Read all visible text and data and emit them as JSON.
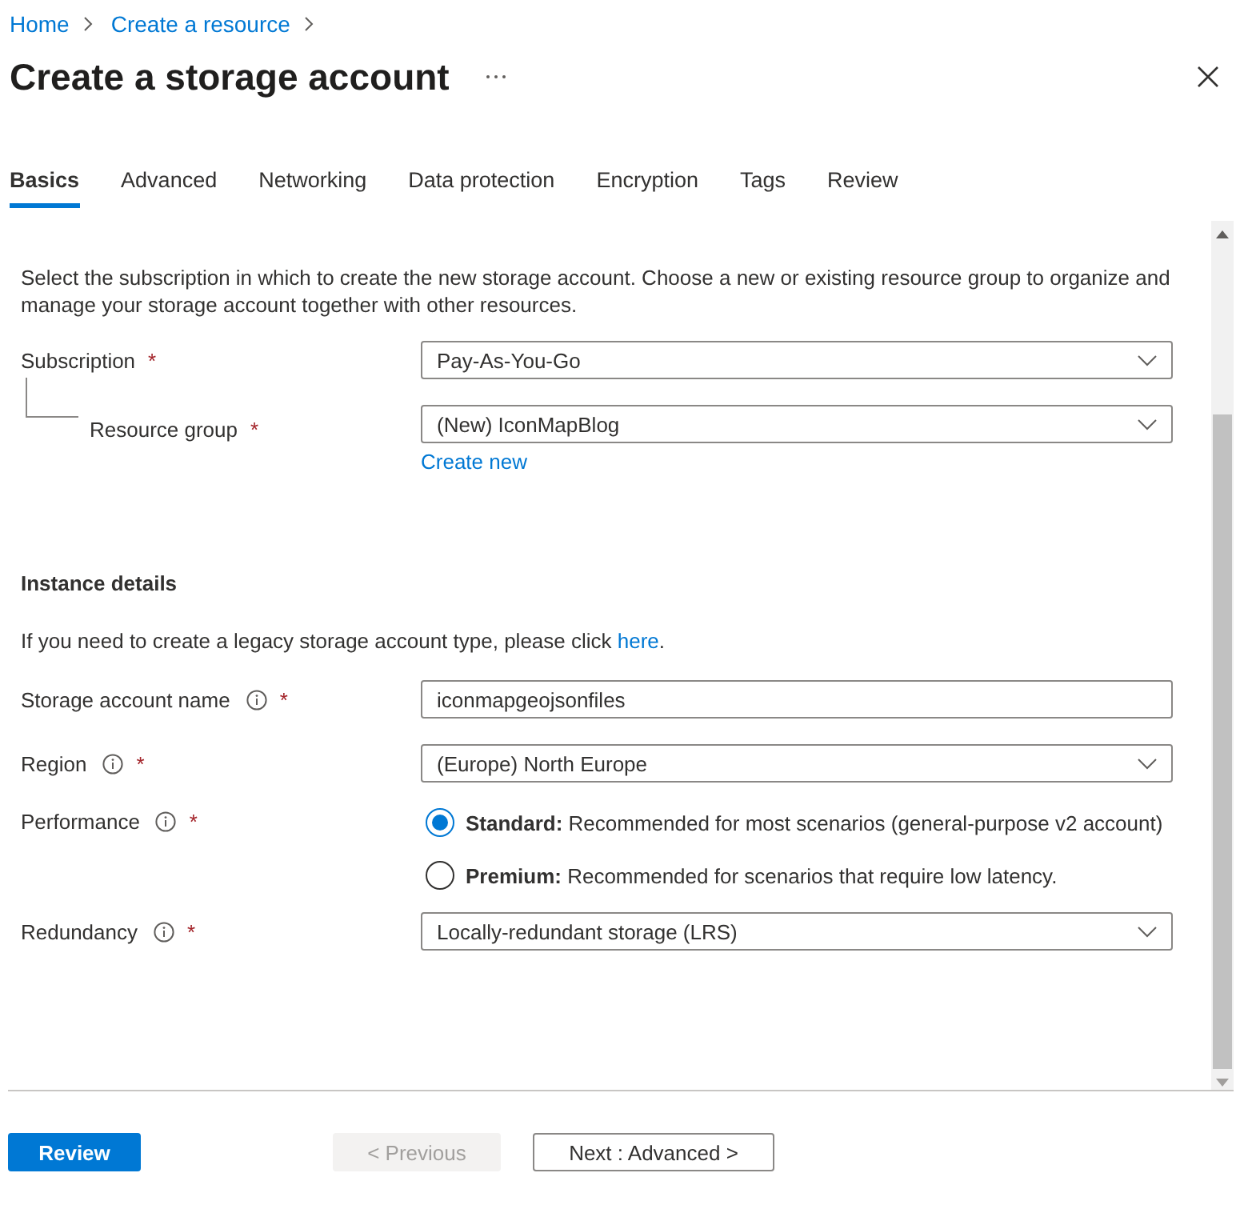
{
  "breadcrumb": [
    {
      "label": "Home"
    },
    {
      "label": "Create a resource"
    }
  ],
  "title": "Create a storage account",
  "tabs": [
    {
      "label": "Basics",
      "selected": true
    },
    {
      "label": "Advanced",
      "selected": false
    },
    {
      "label": "Networking",
      "selected": false
    },
    {
      "label": "Data protection",
      "selected": false
    },
    {
      "label": "Encryption",
      "selected": false
    },
    {
      "label": "Tags",
      "selected": false
    },
    {
      "label": "Review",
      "selected": false
    }
  ],
  "project_details": {
    "description": "Select the subscription in which to create the new storage account. Choose a new or existing resource group to organize and manage your storage account together with other resources.",
    "fields": [
      {
        "kind": "dropdown",
        "label": "Subscription",
        "required_mark": "*",
        "info": false,
        "nested": false,
        "value": "Pay-As-You-Go"
      },
      {
        "kind": "dropdown",
        "label": "Resource group",
        "required_mark": "*",
        "info": false,
        "nested": true,
        "value": "(New) IconMapBlog",
        "link": "Create new"
      }
    ]
  },
  "instance_details": {
    "heading": "Instance details",
    "note": "If you need to create a legacy storage account type, please click",
    "note_link": "here",
    "note_end": ".",
    "fields": [
      {
        "kind": "text",
        "label": "Storage account name",
        "required_mark": "*",
        "info": true,
        "nested": false,
        "value": "iconmapgeojsonfiles"
      },
      {
        "kind": "dropdown",
        "label": "Region",
        "required_mark": "*",
        "info": true,
        "nested": false,
        "value": "(Europe) North Europe"
      },
      {
        "kind": "radio",
        "label": "Performance",
        "required_mark": "*",
        "info": true,
        "nested": false,
        "options": [
          {
            "text": "**Standard:** Recommended for most scenarios (general-purpose v2 account)",
            "selected": true
          },
          {
            "text": "**Premium:** Recommended for scenarios that require low latency.",
            "selected": false
          }
        ]
      },
      {
        "kind": "dropdown",
        "label": "Redundancy",
        "required_mark": "*",
        "info": true,
        "nested": false,
        "value": "Locally-redundant storage (LRS)"
      }
    ]
  },
  "footer": [
    {
      "kind": "primary",
      "label": "Review",
      "disabled": false
    },
    {
      "kind": "secondary",
      "label": "< Previous",
      "disabled": true
    },
    {
      "kind": "secondary",
      "label": "Next : Advanced >",
      "disabled": false
    }
  ]
}
